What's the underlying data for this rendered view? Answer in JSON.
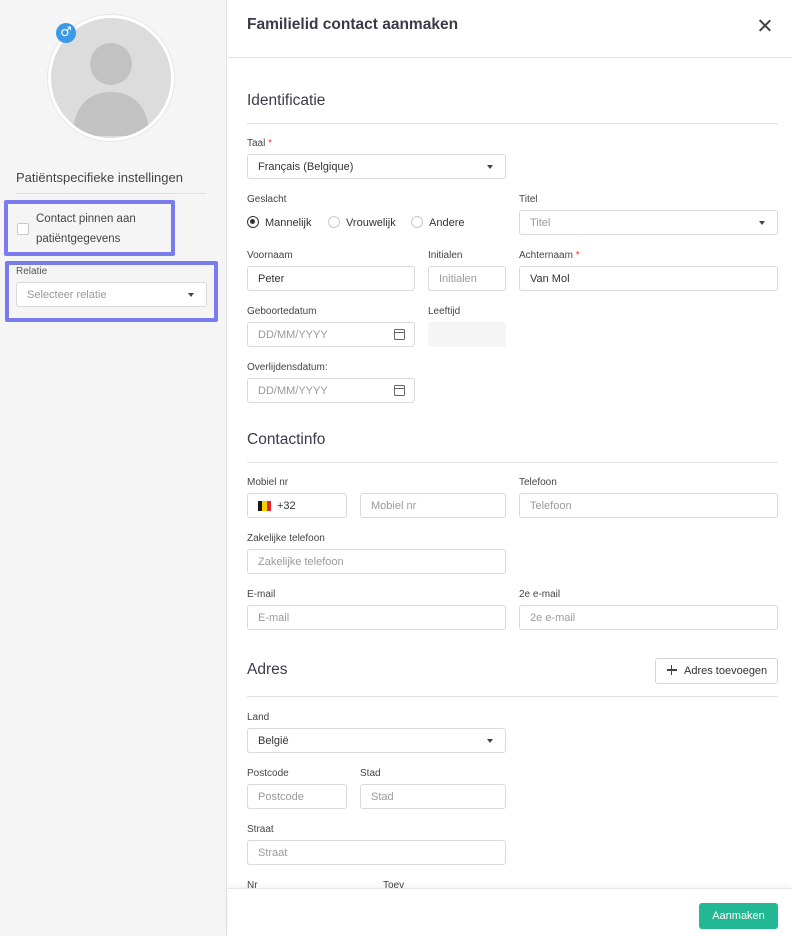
{
  "sidebar": {
    "gender_icon": "male-symbol-icon",
    "gender_glyph": "♂",
    "settings_title": "Patiëntspecifieke instellingen",
    "pin_contact_label": "Contact pinnen aan patiëntgegevens",
    "relation_label": "Relatie",
    "relation_placeholder": "Selecteer relatie"
  },
  "header": {
    "title": "Familielid contact aanmaken"
  },
  "identification": {
    "section_title": "Identificatie",
    "language_label": "Taal",
    "language_value": "Français (Belgique)",
    "gender_label": "Geslacht",
    "gender_options": [
      "Mannelijk",
      "Vrouwelijk",
      "Andere"
    ],
    "gender_selected": "Mannelijk",
    "title_label": "Titel",
    "title_placeholder": "Titel",
    "firstname_label": "Voornaam",
    "firstname_value": "Peter",
    "initials_label": "Initialen",
    "initials_placeholder": "Initialen",
    "lastname_label": "Achternaam",
    "lastname_value": "Van Mol",
    "birthdate_label": "Geboortedatum",
    "birthdate_placeholder": "DD/MM/YYYY",
    "age_label": "Leeftijd",
    "deathdate_label": "Overlijdensdatum:",
    "deathdate_placeholder": "DD/MM/YYYY",
    "required_mark": "*"
  },
  "contact": {
    "section_title": "Contactinfo",
    "mobile_label": "Mobiel nr",
    "country_code": "+32",
    "mobile_placeholder": "Mobiel nr",
    "phone_label": "Telefoon",
    "phone_placeholder": "Telefoon",
    "work_phone_label": "Zakelijke telefoon",
    "work_phone_placeholder": "Zakelijke telefoon",
    "email_label": "E-mail",
    "email_placeholder": "E-mail",
    "email2_label": "2e e-mail",
    "email2_placeholder": "2e e-mail",
    "flag_colors": [
      "#1a1a1a",
      "#f5d000",
      "#e1232b"
    ]
  },
  "address": {
    "section_title": "Adres",
    "add_button": "Adres toevoegen",
    "country_label": "Land",
    "country_value": "België",
    "postcode_label": "Postcode",
    "postcode_placeholder": "Postcode",
    "city_label": "Stad",
    "city_placeholder": "Stad",
    "street_label": "Straat",
    "street_placeholder": "Straat",
    "number_label": "Nr",
    "addition_label": "Toev"
  },
  "footer": {
    "submit_label": "Aanmaken"
  },
  "colors": {
    "accent": "#22b893",
    "highlight": "#7b7bf0",
    "badge": "#3b9ae8",
    "required": "#e23b3b"
  }
}
